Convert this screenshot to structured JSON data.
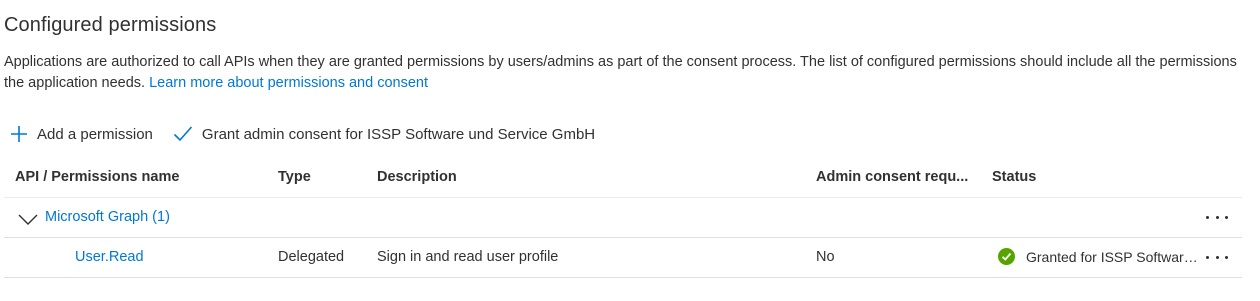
{
  "section": {
    "title": "Configured permissions",
    "description": "Applications are authorized to call APIs when they are granted permissions by users/admins as part of the consent process. The list of configured permissions should include all the permissions the application needs.",
    "learn_more_link": "Learn more about permissions and consent"
  },
  "toolbar": {
    "add_permission_label": "Add a permission",
    "grant_consent_label": "Grant admin consent for ISSP Software und Service GmbH",
    "accent_color": "#0078d4"
  },
  "table": {
    "columns": {
      "name": "API / Permissions name",
      "type": "Type",
      "description": "Description",
      "admin_consent": "Admin consent requ...",
      "status": "Status"
    },
    "groups": [
      {
        "label": "Microsoft Graph (1)",
        "expanded": true,
        "rows": [
          {
            "name": "User.Read",
            "type": "Delegated",
            "description": "Sign in and read user profile",
            "admin_consent": "No",
            "status": "Granted for ISSP Software und Service GmbH",
            "status_icon": "green-checkmark-circle-icon",
            "status_color": "#57a300"
          }
        ]
      }
    ]
  }
}
